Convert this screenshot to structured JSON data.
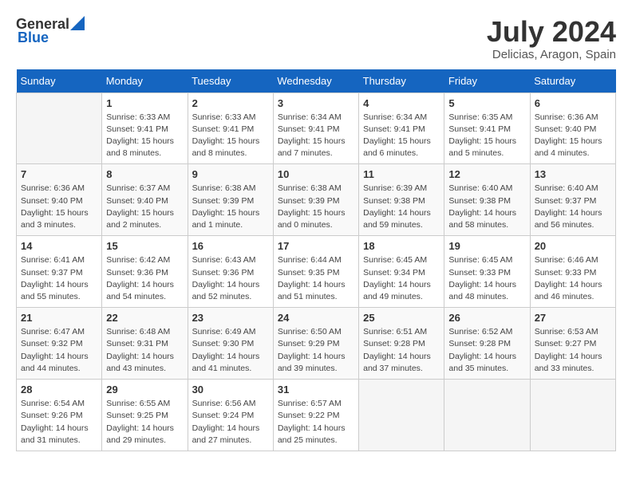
{
  "header": {
    "logo_general": "General",
    "logo_blue": "Blue",
    "title": "July 2024",
    "subtitle": "Delicias, Aragon, Spain"
  },
  "weekdays": [
    "Sunday",
    "Monday",
    "Tuesday",
    "Wednesday",
    "Thursday",
    "Friday",
    "Saturday"
  ],
  "weeks": [
    [
      {
        "day": "",
        "sunrise": "",
        "sunset": "",
        "daylight": ""
      },
      {
        "day": "1",
        "sunrise": "Sunrise: 6:33 AM",
        "sunset": "Sunset: 9:41 PM",
        "daylight": "Daylight: 15 hours and 8 minutes."
      },
      {
        "day": "2",
        "sunrise": "Sunrise: 6:33 AM",
        "sunset": "Sunset: 9:41 PM",
        "daylight": "Daylight: 15 hours and 8 minutes."
      },
      {
        "day": "3",
        "sunrise": "Sunrise: 6:34 AM",
        "sunset": "Sunset: 9:41 PM",
        "daylight": "Daylight: 15 hours and 7 minutes."
      },
      {
        "day": "4",
        "sunrise": "Sunrise: 6:34 AM",
        "sunset": "Sunset: 9:41 PM",
        "daylight": "Daylight: 15 hours and 6 minutes."
      },
      {
        "day": "5",
        "sunrise": "Sunrise: 6:35 AM",
        "sunset": "Sunset: 9:41 PM",
        "daylight": "Daylight: 15 hours and 5 minutes."
      },
      {
        "day": "6",
        "sunrise": "Sunrise: 6:36 AM",
        "sunset": "Sunset: 9:40 PM",
        "daylight": "Daylight: 15 hours and 4 minutes."
      }
    ],
    [
      {
        "day": "7",
        "sunrise": "Sunrise: 6:36 AM",
        "sunset": "Sunset: 9:40 PM",
        "daylight": "Daylight: 15 hours and 3 minutes."
      },
      {
        "day": "8",
        "sunrise": "Sunrise: 6:37 AM",
        "sunset": "Sunset: 9:40 PM",
        "daylight": "Daylight: 15 hours and 2 minutes."
      },
      {
        "day": "9",
        "sunrise": "Sunrise: 6:38 AM",
        "sunset": "Sunset: 9:39 PM",
        "daylight": "Daylight: 15 hours and 1 minute."
      },
      {
        "day": "10",
        "sunrise": "Sunrise: 6:38 AM",
        "sunset": "Sunset: 9:39 PM",
        "daylight": "Daylight: 15 hours and 0 minutes."
      },
      {
        "day": "11",
        "sunrise": "Sunrise: 6:39 AM",
        "sunset": "Sunset: 9:38 PM",
        "daylight": "Daylight: 14 hours and 59 minutes."
      },
      {
        "day": "12",
        "sunrise": "Sunrise: 6:40 AM",
        "sunset": "Sunset: 9:38 PM",
        "daylight": "Daylight: 14 hours and 58 minutes."
      },
      {
        "day": "13",
        "sunrise": "Sunrise: 6:40 AM",
        "sunset": "Sunset: 9:37 PM",
        "daylight": "Daylight: 14 hours and 56 minutes."
      }
    ],
    [
      {
        "day": "14",
        "sunrise": "Sunrise: 6:41 AM",
        "sunset": "Sunset: 9:37 PM",
        "daylight": "Daylight: 14 hours and 55 minutes."
      },
      {
        "day": "15",
        "sunrise": "Sunrise: 6:42 AM",
        "sunset": "Sunset: 9:36 PM",
        "daylight": "Daylight: 14 hours and 54 minutes."
      },
      {
        "day": "16",
        "sunrise": "Sunrise: 6:43 AM",
        "sunset": "Sunset: 9:36 PM",
        "daylight": "Daylight: 14 hours and 52 minutes."
      },
      {
        "day": "17",
        "sunrise": "Sunrise: 6:44 AM",
        "sunset": "Sunset: 9:35 PM",
        "daylight": "Daylight: 14 hours and 51 minutes."
      },
      {
        "day": "18",
        "sunrise": "Sunrise: 6:45 AM",
        "sunset": "Sunset: 9:34 PM",
        "daylight": "Daylight: 14 hours and 49 minutes."
      },
      {
        "day": "19",
        "sunrise": "Sunrise: 6:45 AM",
        "sunset": "Sunset: 9:33 PM",
        "daylight": "Daylight: 14 hours and 48 minutes."
      },
      {
        "day": "20",
        "sunrise": "Sunrise: 6:46 AM",
        "sunset": "Sunset: 9:33 PM",
        "daylight": "Daylight: 14 hours and 46 minutes."
      }
    ],
    [
      {
        "day": "21",
        "sunrise": "Sunrise: 6:47 AM",
        "sunset": "Sunset: 9:32 PM",
        "daylight": "Daylight: 14 hours and 44 minutes."
      },
      {
        "day": "22",
        "sunrise": "Sunrise: 6:48 AM",
        "sunset": "Sunset: 9:31 PM",
        "daylight": "Daylight: 14 hours and 43 minutes."
      },
      {
        "day": "23",
        "sunrise": "Sunrise: 6:49 AM",
        "sunset": "Sunset: 9:30 PM",
        "daylight": "Daylight: 14 hours and 41 minutes."
      },
      {
        "day": "24",
        "sunrise": "Sunrise: 6:50 AM",
        "sunset": "Sunset: 9:29 PM",
        "daylight": "Daylight: 14 hours and 39 minutes."
      },
      {
        "day": "25",
        "sunrise": "Sunrise: 6:51 AM",
        "sunset": "Sunset: 9:28 PM",
        "daylight": "Daylight: 14 hours and 37 minutes."
      },
      {
        "day": "26",
        "sunrise": "Sunrise: 6:52 AM",
        "sunset": "Sunset: 9:28 PM",
        "daylight": "Daylight: 14 hours and 35 minutes."
      },
      {
        "day": "27",
        "sunrise": "Sunrise: 6:53 AM",
        "sunset": "Sunset: 9:27 PM",
        "daylight": "Daylight: 14 hours and 33 minutes."
      }
    ],
    [
      {
        "day": "28",
        "sunrise": "Sunrise: 6:54 AM",
        "sunset": "Sunset: 9:26 PM",
        "daylight": "Daylight: 14 hours and 31 minutes."
      },
      {
        "day": "29",
        "sunrise": "Sunrise: 6:55 AM",
        "sunset": "Sunset: 9:25 PM",
        "daylight": "Daylight: 14 hours and 29 minutes."
      },
      {
        "day": "30",
        "sunrise": "Sunrise: 6:56 AM",
        "sunset": "Sunset: 9:24 PM",
        "daylight": "Daylight: 14 hours and 27 minutes."
      },
      {
        "day": "31",
        "sunrise": "Sunrise: 6:57 AM",
        "sunset": "Sunset: 9:22 PM",
        "daylight": "Daylight: 14 hours and 25 minutes."
      },
      {
        "day": "",
        "sunrise": "",
        "sunset": "",
        "daylight": ""
      },
      {
        "day": "",
        "sunrise": "",
        "sunset": "",
        "daylight": ""
      },
      {
        "day": "",
        "sunrise": "",
        "sunset": "",
        "daylight": ""
      }
    ]
  ]
}
